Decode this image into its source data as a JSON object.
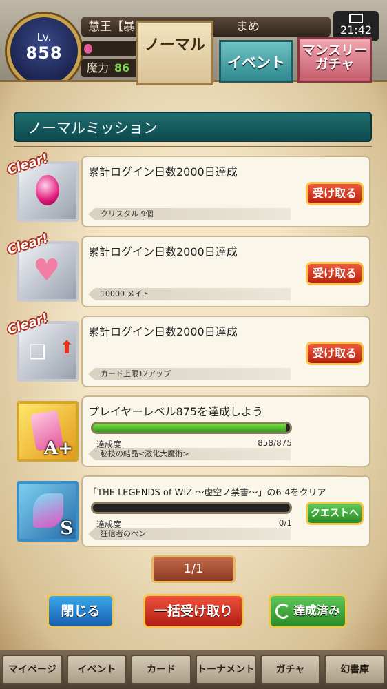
{
  "player": {
    "level_label": "Lv.",
    "level": "858",
    "name": "慧王【暴",
    "nickname": "まめ",
    "magic_label": "魔力",
    "magic_value": "86"
  },
  "status_bar": {
    "time": "21:42"
  },
  "tabs": [
    {
      "label": "ノーマル",
      "active": true
    },
    {
      "label": "イベント",
      "active": false
    },
    {
      "label": "マンスリーガチャ",
      "active": false
    }
  ],
  "section_title": "ノーマルミッション",
  "clear_badge": "Clear!",
  "missions": [
    {
      "title": "累計ログイン日数2000日達成",
      "reward": "クリスタル 9個",
      "icon": "pink-crystal-icon",
      "cleared": true,
      "button": "受け取る"
    },
    {
      "title": "累計ログイン日数2000日達成",
      "reward": "10000 メイト",
      "icon": "handshake-heart-icon",
      "cleared": true,
      "button": "受け取る"
    },
    {
      "title": "累計ログイン日数2000日達成",
      "reward": "カード上限12アップ",
      "icon": "card-limit-up-icon",
      "cleared": true,
      "button": "受け取る"
    },
    {
      "title": "プレイヤーレベル875を達成しよう",
      "progress_label": "達成度",
      "progress_text": "858/875",
      "progress_value": 0.98,
      "reward": "秘技の結晶<激化大魔術>",
      "icon": "skill-crystal-icon",
      "rank": "A+",
      "cleared": false
    },
    {
      "title": "「THE LEGENDS of WIZ 〜虚空ノ禁書〜」の6-4をクリア",
      "progress_label": "達成度",
      "progress_text": "0/1",
      "progress_value": 0.0,
      "reward": "狂信者のペン",
      "icon": "feather-pen-icon",
      "rank": "S",
      "cleared": false,
      "button": "クエストへ"
    }
  ],
  "pager": "1/1",
  "buttons": {
    "close": "閉じる",
    "receive_all": "一括受け取り",
    "completed": "達成済み"
  },
  "nav": [
    "マイページ",
    "イベント",
    "カード",
    "トーナメント",
    "ガチャ",
    "幻書庫"
  ],
  "colors": {
    "title_bar": "#0e4a4e",
    "receive_button": "#b8200f",
    "quest_button": "#2a8a26",
    "close_button": "#1a5fb0",
    "progress_fill": "#2e9a18"
  }
}
